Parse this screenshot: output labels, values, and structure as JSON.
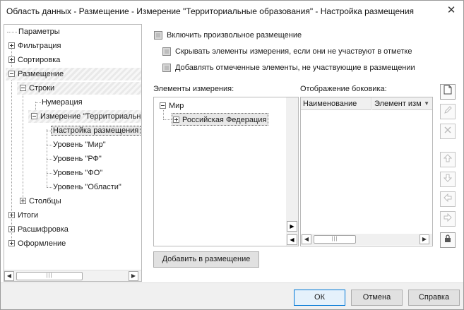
{
  "window": {
    "title": "Область данных - Размещение - Измерение \"Территориальные образования\" - Настройка размещения",
    "close_glyph": "✕"
  },
  "tree": {
    "items": [
      {
        "label": "Параметры",
        "expander": "none"
      },
      {
        "label": "Фильтрация",
        "expander": "plus"
      },
      {
        "label": "Сортировка",
        "expander": "plus"
      },
      {
        "label": "Размещение",
        "expander": "minus"
      },
      {
        "label": "Строки",
        "expander": "minus"
      },
      {
        "label": "Нумерация",
        "expander": "none"
      },
      {
        "label": "Измерение \"Территориальные образования\"",
        "expander": "minus"
      },
      {
        "label": "Настройка размещения",
        "expander": "none",
        "selected": true
      },
      {
        "label": "Уровень \"Мир\"",
        "expander": "none"
      },
      {
        "label": "Уровень \"РФ\"",
        "expander": "none"
      },
      {
        "label": "Уровень \"ФО\"",
        "expander": "none"
      },
      {
        "label": "Уровень \"Области\"",
        "expander": "none"
      },
      {
        "label": "Столбцы",
        "expander": "plus"
      },
      {
        "label": "Итоги",
        "expander": "plus"
      },
      {
        "label": "Расшифровка",
        "expander": "plus"
      },
      {
        "label": "Оформление",
        "expander": "plus"
      }
    ]
  },
  "options": {
    "custom_placement": "Включить произвольное размещение",
    "hide_unmarked": "Скрывать элементы измерения, если они не участвуют в отметке",
    "add_marked": "Добавлять отмеченные элементы, не участвующие в размещении"
  },
  "elements_panel": {
    "label": "Элементы измерения:",
    "nodes": [
      {
        "label": "Мир",
        "expander": "minus"
      },
      {
        "label": "Российская Федерация",
        "expander": "plus"
      }
    ]
  },
  "sidebar_panel": {
    "label": "Отображение боковика:",
    "columns": [
      "Наименование",
      "Элемент изм"
    ]
  },
  "buttons": {
    "add_to_placement": "Добавить в размещение",
    "ok": "ОК",
    "cancel": "Отмена",
    "help": "Справка"
  },
  "icons": {
    "scroll_left": "◀",
    "scroll_right": "▶",
    "thumb_grip": "|||",
    "tools": [
      "new-document-icon",
      "edit-icon",
      "delete-icon",
      "move-up-icon",
      "move-down-icon",
      "move-left-icon",
      "move-right-icon",
      "lock-icon"
    ]
  }
}
